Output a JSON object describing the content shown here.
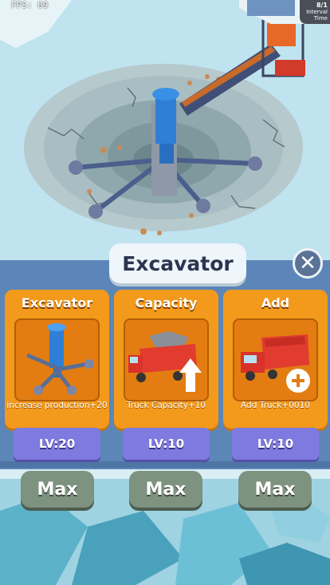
{
  "hud": {
    "fps": "FPS: 69",
    "counter": "8/1",
    "sublabel": "Interval Time"
  },
  "panel": {
    "title": "Excavator"
  },
  "cards": [
    {
      "header": "Excavator",
      "desc": "increase production+20",
      "icon": "excavator-icon",
      "level": "LV:20",
      "max_label": "Max"
    },
    {
      "header": "Capacity",
      "desc": "Truck Capacity+10",
      "icon": "truck-capacity-icon",
      "level": "LV:10",
      "max_label": "Max"
    },
    {
      "header": "Add",
      "desc": "Add Truck+0010",
      "icon": "add-truck-icon",
      "level": "LV:10",
      "max_label": "Max"
    }
  ],
  "colors": {
    "panel": "#5c86b8",
    "card": "#f39a1c",
    "level": "#7f7ae0",
    "max": "#7e9280"
  }
}
